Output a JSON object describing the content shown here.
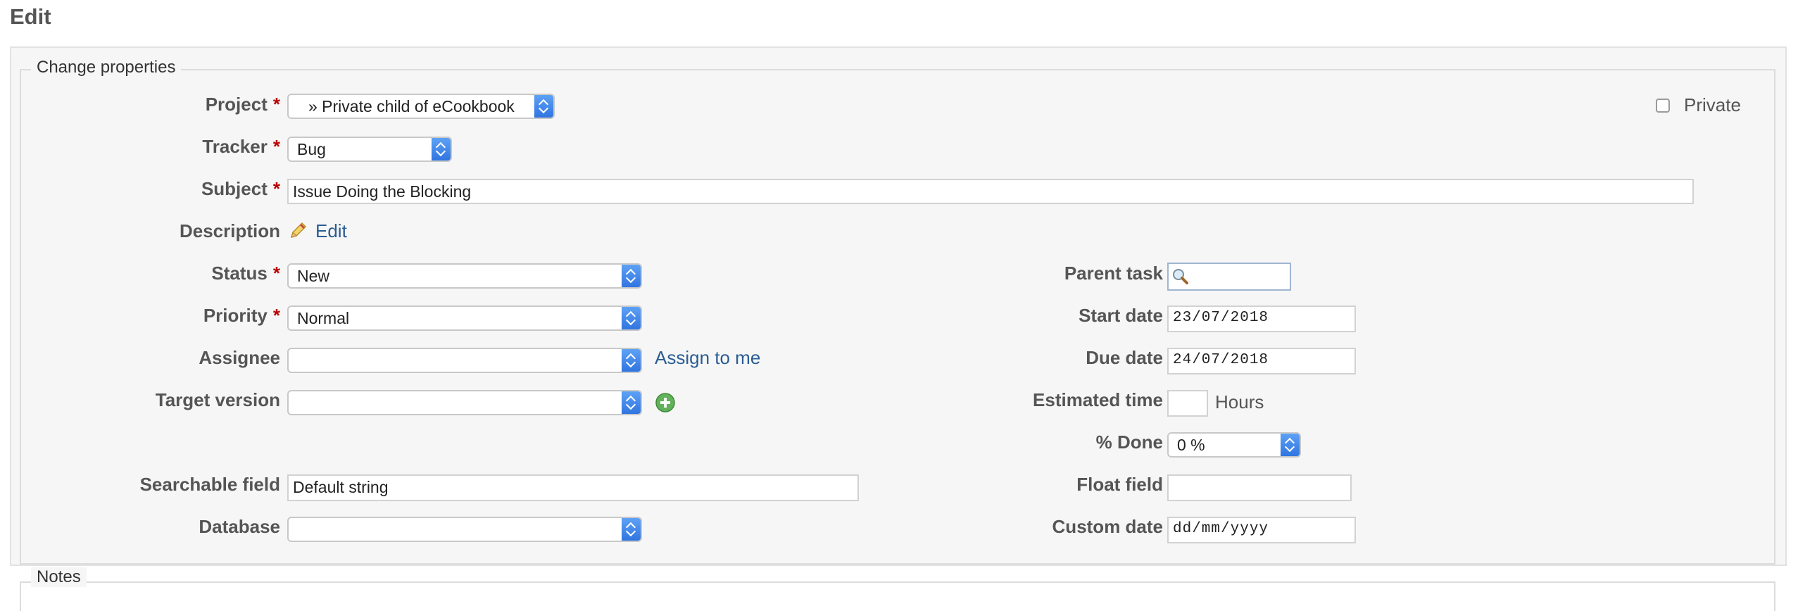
{
  "page": {
    "title": "Edit"
  },
  "fieldset": {
    "legend": "Change properties",
    "notes_legend": "Notes"
  },
  "fields": {
    "project": {
      "label": "Project",
      "required": "*",
      "value": "» Private child of eCookbook"
    },
    "private": {
      "label": "Private",
      "checked": false
    },
    "tracker": {
      "label": "Tracker",
      "required": "*",
      "value": "Bug"
    },
    "subject": {
      "label": "Subject",
      "required": "*",
      "value": "Issue Doing the Blocking"
    },
    "description": {
      "label": "Description",
      "edit_link": "Edit",
      "icon": "pencil-icon"
    },
    "status": {
      "label": "Status",
      "required": "*",
      "value": "New"
    },
    "priority": {
      "label": "Priority",
      "required": "*",
      "value": "Normal"
    },
    "assignee": {
      "label": "Assignee",
      "value": "",
      "assign_link": "Assign to me"
    },
    "target_version": {
      "label": "Target version",
      "value": "",
      "icon": "add-icon"
    },
    "parent_task": {
      "label": "Parent task",
      "value": "",
      "icon": "magnifier-icon"
    },
    "start_date": {
      "label": "Start date",
      "value": "23/07/2018"
    },
    "due_date": {
      "label": "Due date",
      "value": "24/07/2018"
    },
    "estimated_time": {
      "label": "Estimated time",
      "value": "",
      "unit": "Hours"
    },
    "done_ratio": {
      "label": "% Done",
      "value": "0 %"
    },
    "searchable_field": {
      "label": "Searchable field",
      "value": "Default string"
    },
    "float_field": {
      "label": "Float field",
      "value": ""
    },
    "database": {
      "label": "Database",
      "value": ""
    },
    "custom_date": {
      "label": "Custom date",
      "value": "dd/mm/yyyy"
    }
  },
  "colors": {
    "required": "#bb0000",
    "link": "#2a5d93",
    "select_accent": "#3b82f0",
    "add_icon": "#62b25b"
  }
}
